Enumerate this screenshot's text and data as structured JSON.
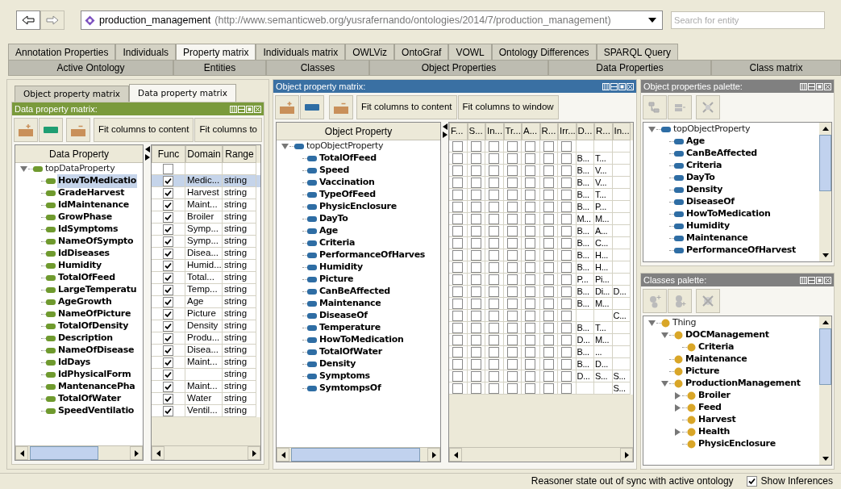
{
  "toolbar": {
    "ontology_name": "production_management",
    "ontology_iri": "(http://www.semanticweb.org/yusrafernando/ontologies/2014/7/production_management)",
    "search_placeholder": "Search for entity"
  },
  "tabs_row1": [
    {
      "label": "Annotation Properties",
      "selected": false
    },
    {
      "label": "Individuals",
      "selected": false
    },
    {
      "label": "Property matrix",
      "selected": true
    },
    {
      "label": "Individuals matrix",
      "selected": false
    },
    {
      "label": "OWLViz",
      "selected": false
    },
    {
      "label": "OntoGraf",
      "selected": false
    },
    {
      "label": "VOWL",
      "selected": false
    },
    {
      "label": "Ontology Differences",
      "selected": false
    },
    {
      "label": "SPARQL Query",
      "selected": false
    }
  ],
  "tabs_row2": [
    {
      "label": "Active Ontology",
      "selected": false
    },
    {
      "label": "Entities",
      "selected": false
    },
    {
      "label": "Classes",
      "selected": false
    },
    {
      "label": "Object Properties",
      "selected": false
    },
    {
      "label": "Data Properties",
      "selected": false
    },
    {
      "label": "Class matrix",
      "selected": false
    }
  ],
  "data_property_panel": {
    "subtabs": [
      {
        "label": "Object property matrix",
        "selected": false
      },
      {
        "label": "Data property matrix",
        "selected": true
      }
    ],
    "title": "Data property matrix:",
    "buttons": [
      "Fit columns to content",
      "Fit columns to"
    ],
    "tree_header": "Data Property",
    "columns": [
      "Func",
      "Domain",
      "Range"
    ],
    "root": {
      "name": "topDataProperty",
      "expanded": true,
      "func": false
    },
    "rows": [
      {
        "name": "HowToMedicatio",
        "selected": true,
        "func": true,
        "domain": "Medic...",
        "range": "string"
      },
      {
        "name": "GradeHarvest",
        "selected": false,
        "func": true,
        "domain": "Harvest",
        "range": "string"
      },
      {
        "name": "IdMaintenance",
        "selected": false,
        "func": true,
        "domain": "Maint...",
        "range": "string"
      },
      {
        "name": "GrowPhase",
        "selected": false,
        "func": true,
        "domain": "Broiler",
        "range": "string"
      },
      {
        "name": "IdSymptoms",
        "selected": false,
        "func": true,
        "domain": "Symp...",
        "range": "string"
      },
      {
        "name": "NameOfSympto",
        "selected": false,
        "func": true,
        "domain": "Symp...",
        "range": "string"
      },
      {
        "name": "IdDiseases",
        "selected": false,
        "func": true,
        "domain": "Disea...",
        "range": "string"
      },
      {
        "name": "Humidity",
        "selected": false,
        "func": true,
        "domain": "Humid...",
        "range": "string"
      },
      {
        "name": "TotalOfFeed",
        "selected": false,
        "func": true,
        "domain": "Total...",
        "range": "string"
      },
      {
        "name": "LargeTemperatu",
        "selected": false,
        "func": true,
        "domain": "Temp...",
        "range": "string"
      },
      {
        "name": "AgeGrowth",
        "selected": false,
        "func": true,
        "domain": "Age",
        "range": "string"
      },
      {
        "name": "NameOfPicture",
        "selected": false,
        "func": true,
        "domain": "Picture",
        "range": "string"
      },
      {
        "name": "TotalOfDensity",
        "selected": false,
        "func": true,
        "domain": "Density",
        "range": "string"
      },
      {
        "name": "Description",
        "selected": false,
        "func": true,
        "domain": "Produ...",
        "range": "string"
      },
      {
        "name": "NameOfDisease",
        "selected": false,
        "func": true,
        "domain": "Disea...",
        "range": "string"
      },
      {
        "name": "IdDays",
        "selected": false,
        "func": true,
        "domain": "Maint...",
        "range": "string"
      },
      {
        "name": "IdPhysicalForm",
        "selected": false,
        "func": true,
        "range": "string"
      },
      {
        "name": "MantenancePha",
        "selected": false,
        "func": true,
        "domain": "Maint...",
        "range": "string"
      },
      {
        "name": "TotalOfWater",
        "selected": false,
        "func": true,
        "domain": "Water",
        "range": "string"
      },
      {
        "name": "SpeedVentilatio",
        "selected": false,
        "func": true,
        "domain": "Ventil...",
        "range": "string"
      }
    ]
  },
  "object_property_panel": {
    "title": "Object property matrix:",
    "buttons": [
      "Fit columns to content",
      "Fit columns to window"
    ],
    "tree_header": "Object Property",
    "columns": [
      "F...",
      "S...",
      "In...",
      "Tr...",
      "A...",
      "R...",
      "Irr...",
      "D...",
      "R...",
      "In..."
    ],
    "root": {
      "name": "topObjectProperty",
      "expanded": true,
      "flags": [
        false,
        false,
        false,
        false,
        false,
        false,
        false
      ]
    },
    "rows": [
      {
        "name": "TotalOfFeed",
        "selected": false,
        "flags": [
          false,
          false,
          false,
          false,
          false,
          false,
          false
        ],
        "domain": "B...",
        "range": "T..."
      },
      {
        "name": "Speed",
        "selected": false,
        "flags": [
          false,
          false,
          false,
          false,
          false,
          false,
          false
        ],
        "domain": "B...",
        "range": "V..."
      },
      {
        "name": "Vaccination",
        "selected": false,
        "flags": [
          false,
          false,
          false,
          false,
          false,
          false,
          false
        ],
        "domain": "B...",
        "range": "V..."
      },
      {
        "name": "TypeOfFeed",
        "selected": false,
        "flags": [
          false,
          false,
          false,
          false,
          false,
          false,
          false
        ],
        "domain": "B...",
        "range": "T..."
      },
      {
        "name": "PhysicEnclosure",
        "selected": false,
        "flags": [
          false,
          false,
          false,
          false,
          false,
          false,
          false
        ],
        "domain": "B...",
        "range": "P..."
      },
      {
        "name": "DayTo",
        "selected": false,
        "flags": [
          false,
          false,
          false,
          false,
          false,
          false,
          false
        ],
        "domain": "M...",
        "range": "M..."
      },
      {
        "name": "Age",
        "selected": false,
        "flags": [
          false,
          false,
          false,
          false,
          false,
          false,
          false
        ],
        "domain": "B...",
        "range": "A..."
      },
      {
        "name": "Criteria",
        "selected": false,
        "flags": [
          false,
          false,
          false,
          false,
          false,
          false,
          false
        ],
        "domain": "B...",
        "range": "C..."
      },
      {
        "name": "PerformanceOfHarves",
        "selected": false,
        "flags": [
          false,
          false,
          false,
          false,
          false,
          false,
          false
        ],
        "domain": "B...",
        "range": "H..."
      },
      {
        "name": "Humidity",
        "selected": false,
        "flags": [
          false,
          false,
          false,
          false,
          false,
          false,
          false
        ],
        "domain": "B...",
        "range": "H..."
      },
      {
        "name": "Picture",
        "selected": false,
        "flags": [
          false,
          false,
          false,
          false,
          false,
          false,
          false
        ],
        "domain": "P...",
        "range": "Pi..."
      },
      {
        "name": "CanBeAffected",
        "selected": false,
        "flags": [
          false,
          false,
          false,
          false,
          false,
          false,
          false
        ],
        "domain": "B...",
        "range": "Di...",
        "inverse": "D..."
      },
      {
        "name": "Maintenance",
        "selected": false,
        "flags": [
          false,
          false,
          false,
          false,
          false,
          false,
          false
        ],
        "domain": "B...",
        "range": "M..."
      },
      {
        "name": "DiseaseOf",
        "selected": false,
        "flags": [
          false,
          false,
          false,
          false,
          false,
          false,
          false
        ],
        "inverse": "C..."
      },
      {
        "name": "Temperature",
        "selected": false,
        "flags": [
          false,
          false,
          false,
          false,
          false,
          false,
          false
        ],
        "domain": "B...",
        "range": "T..."
      },
      {
        "name": "HowToMedication",
        "selected": false,
        "flags": [
          false,
          false,
          false,
          false,
          false,
          false,
          false
        ],
        "domain": "D...",
        "range": "M..."
      },
      {
        "name": "TotalOfWater",
        "selected": false,
        "flags": [
          false,
          false,
          false,
          false,
          false,
          false,
          false
        ],
        "domain": "B...",
        "range": "..."
      },
      {
        "name": "Density",
        "selected": false,
        "flags": [
          false,
          false,
          false,
          false,
          false,
          false,
          false
        ],
        "domain": "B...",
        "range": "D..."
      },
      {
        "name": "Symptoms",
        "selected": false,
        "flags": [
          false,
          false,
          false,
          false,
          false,
          false,
          false
        ],
        "domain": "D...",
        "range": "S...",
        "inverse": "S..."
      },
      {
        "name": "SymtompsOf",
        "selected": false,
        "flags": [
          false,
          false,
          false,
          false,
          false,
          false,
          false
        ],
        "inverse": "S..."
      }
    ]
  },
  "object_properties_palette": {
    "title": "Object properties palette:",
    "tree": {
      "name": "topObjectProperty",
      "expanded": true,
      "children": [
        {
          "name": "Age"
        },
        {
          "name": "CanBeAffected"
        },
        {
          "name": "Criteria"
        },
        {
          "name": "DayTo"
        },
        {
          "name": "Density"
        },
        {
          "name": "DiseaseOf"
        },
        {
          "name": "HowToMedication"
        },
        {
          "name": "Humidity"
        },
        {
          "name": "Maintenance"
        },
        {
          "name": "PerformanceOfHarvest"
        }
      ]
    }
  },
  "classes_palette": {
    "title": "Classes palette:",
    "tree": {
      "name": "Thing",
      "expanded": true,
      "children": [
        {
          "name": "DOCManagement",
          "expanded": true,
          "children": [
            {
              "name": "Criteria"
            }
          ]
        },
        {
          "name": "Maintenance"
        },
        {
          "name": "Picture"
        },
        {
          "name": "ProductionManagement",
          "expanded": true,
          "children": [
            {
              "name": "Broiler",
              "expanded": false
            },
            {
              "name": "Feed",
              "expanded": false
            },
            {
              "name": "Harvest"
            },
            {
              "name": "Health",
              "expanded": false
            },
            {
              "name": "PhysicEnclosure"
            }
          ]
        }
      ]
    }
  },
  "status_bar": {
    "message": "Reasoner state out of sync with active ontology",
    "show_inferences": {
      "label": "Show Inferences",
      "checked": true
    }
  }
}
